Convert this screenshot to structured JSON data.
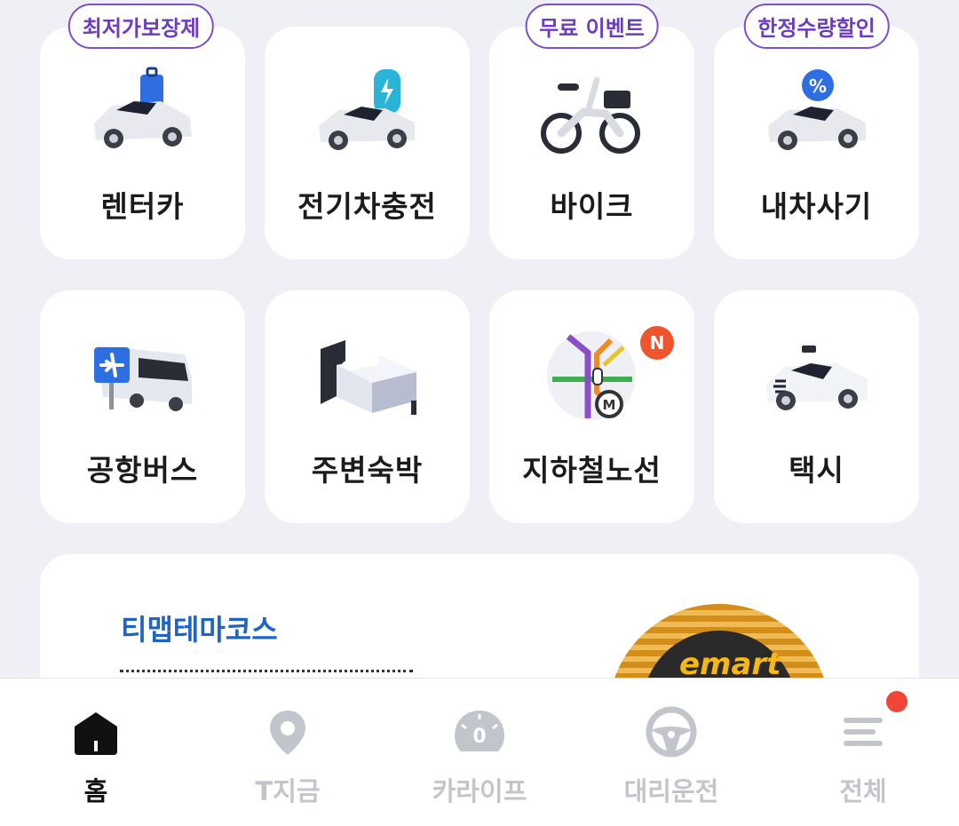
{
  "services": [
    {
      "label": "렌터카",
      "icon": "rental-car-icon",
      "promo": "최저가보장제",
      "new": ""
    },
    {
      "label": "전기차충전",
      "icon": "ev-charging-icon",
      "promo": "",
      "new": ""
    },
    {
      "label": "바이크",
      "icon": "bike-icon",
      "promo": "무료 이벤트",
      "new": ""
    },
    {
      "label": "내차사기",
      "icon": "buy-car-icon",
      "promo": "한정수량할인",
      "new": ""
    },
    {
      "label": "공항버스",
      "icon": "airport-bus-icon",
      "promo": "",
      "new": ""
    },
    {
      "label": "주변숙박",
      "icon": "bed-icon",
      "promo": "",
      "new": ""
    },
    {
      "label": "지하철노선",
      "icon": "subway-map-icon",
      "promo": "",
      "new": "N"
    },
    {
      "label": "택시",
      "icon": "taxi-icon",
      "promo": "",
      "new": ""
    }
  ],
  "banner": {
    "title": "티맵테마코스",
    "logo_text": "emart"
  },
  "bottom_nav": [
    {
      "label": "홈",
      "icon": "home-icon",
      "active": true
    },
    {
      "label": "T지금",
      "icon": "location-pin-icon",
      "active": false
    },
    {
      "label": "카라이프",
      "icon": "speedometer-icon",
      "active": false
    },
    {
      "label": "대리운전",
      "icon": "steering-wheel-icon",
      "active": false
    },
    {
      "label": "전체",
      "icon": "menu-icon",
      "active": false,
      "badge_dot": true
    }
  ],
  "colors": {
    "background": "#eef0f5",
    "promo_purple": "#6d3cc0",
    "banner_title_blue": "#1f63c4",
    "new_badge": "#f0542c",
    "inactive_tab": "#c2c5cc"
  }
}
